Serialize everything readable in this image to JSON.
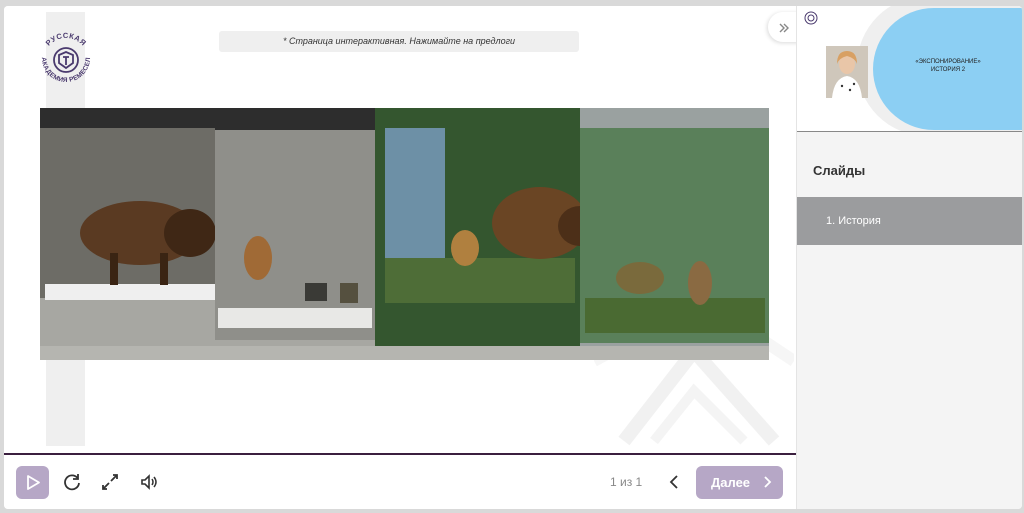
{
  "hint": {
    "text": "* Страница интерактивная. Нажимайте на предлоги"
  },
  "logo": {
    "top_text": "РУССКАЯ",
    "bottom_text": "АКАДЕМИЯ РЕМЕСЕЛ"
  },
  "controls": {
    "page_counter": "1 из 1",
    "next_label": "Далее"
  },
  "sidebar": {
    "preview_caption_line1": "«ЭКСПОНИРОВАНИЕ»",
    "preview_caption_line2": "ИСТОРИЯ 2",
    "heading": "Слайды",
    "items": [
      {
        "label": "1. История"
      }
    ]
  },
  "colors": {
    "accent": "#b6a7c6",
    "progress": "#3b1f3f",
    "logo": "#4a3a6e",
    "preview_blue": "#8ccff3",
    "selected_item": "#9b9c9e"
  },
  "icons": [
    "play-icon",
    "replay-icon",
    "fullscreen-icon",
    "volume-icon",
    "chevron-left-icon",
    "chevron-right-icon",
    "double-chevron-right-icon"
  ]
}
